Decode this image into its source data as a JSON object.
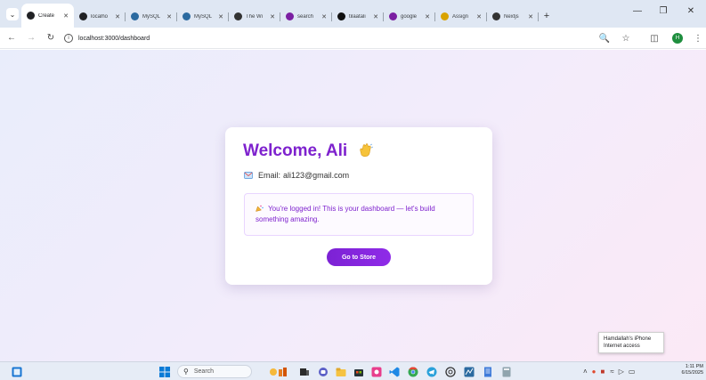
{
  "browser": {
    "tabs": [
      {
        "title": "Create",
        "icon": "globe-dark-icon",
        "color": "#202124",
        "active": true
      },
      {
        "title": "localho",
        "icon": "globe-dark-icon",
        "color": "#202124"
      },
      {
        "title": "MySQL",
        "icon": "mysql-icon",
        "color": "#2b6aa0"
      },
      {
        "title": "MySQL",
        "icon": "mysql-icon",
        "color": "#2b6aa0"
      },
      {
        "title": "The Wi",
        "icon": "book-icon",
        "color": "#333333"
      },
      {
        "title": "search",
        "icon": "checkbox-icon",
        "color": "#7b1fa2"
      },
      {
        "title": "tilaatali",
        "icon": "github-icon",
        "color": "#111111"
      },
      {
        "title": "google",
        "icon": "checkbox-icon",
        "color": "#7b1fa2"
      },
      {
        "title": "Assign",
        "icon": "assignment-icon",
        "color": "#d9a300"
      },
      {
        "title": "Nextjs",
        "icon": "chatgpt-icon",
        "color": "#333333"
      }
    ],
    "new_tab_symbol": "+",
    "url": "localhost:3000/dashboard",
    "profile_initial": "H"
  },
  "dashboard": {
    "title": "Welcome, Ali",
    "email_label": "Email:",
    "email": "ali123@gmail.com",
    "message": "You're logged in! This is your dashboard — let's build something amazing.",
    "button_label": "Go to Store"
  },
  "tooltip": {
    "line1": "Hamdallah's iPhone",
    "line2": "Internet access"
  },
  "taskbar": {
    "search_placeholder": "Search",
    "time": "1:11 PM",
    "date": "6/15/2025"
  },
  "colors": {
    "accent": "#7e22ce",
    "button": "#8a2be2"
  }
}
